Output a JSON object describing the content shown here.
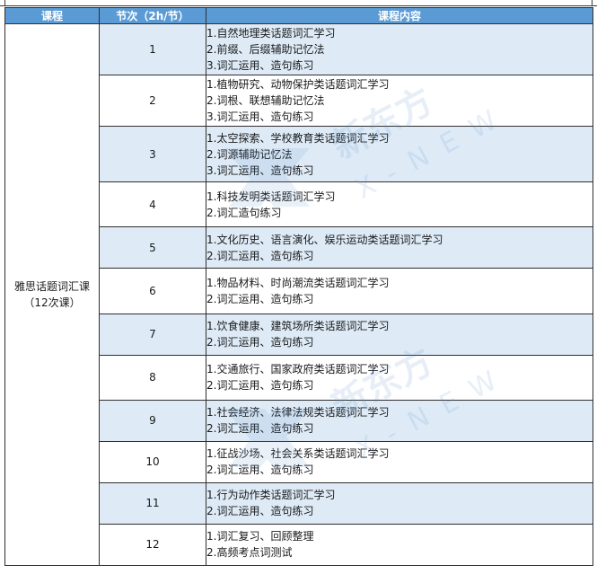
{
  "headers": {
    "course": "课程",
    "session": "节次（2h/节）",
    "content": "课程内容"
  },
  "course": {
    "name": "雅思话题词汇课",
    "count": "（12次课）"
  },
  "rows": [
    {
      "num": "1",
      "lines": [
        "1.自然地理类话题词汇学习",
        "2.前缀、后缀辅助记忆法",
        "3.词汇运用、造句练习"
      ]
    },
    {
      "num": "2",
      "lines": [
        "1.植物研究、动物保护类话题词汇学习",
        "2.词根、联想辅助记忆法",
        "3.词汇运用、造句练习"
      ]
    },
    {
      "num": "3",
      "lines": [
        "1.太空探索、学校教育类话题词汇学习",
        "2.词源辅助记忆法",
        "3.词汇运用、造句练习"
      ]
    },
    {
      "num": "4",
      "lines": [
        "1.科技发明类话题词汇学习",
        "2.词汇造句练习"
      ]
    },
    {
      "num": "5",
      "lines": [
        "1.文化历史、语言演化、娱乐运动类话题词汇学习",
        "2.词汇运用、造句练习"
      ]
    },
    {
      "num": "6",
      "lines": [
        "1.物品材料、时尚潮流类话题词汇学习",
        "2.词汇运用、造句练习"
      ]
    },
    {
      "num": "7",
      "lines": [
        "1.饮食健康、建筑场所类话题词汇学习",
        "2.词汇运用、造句练习"
      ]
    },
    {
      "num": "8",
      "lines": [
        "1.交通旅行、国家政府类话题词汇学习",
        "2.词汇运用、造句练习"
      ]
    },
    {
      "num": "9",
      "lines": [
        "1.社会经济、法律法规类话题词汇学习",
        "2.词汇运用、造句练习"
      ]
    },
    {
      "num": "10",
      "lines": [
        "1.征战沙场、社会关系类话题词汇学习",
        "2.词汇运用、造句练习"
      ]
    },
    {
      "num": "11",
      "lines": [
        "1.行为动作类话题词汇学习",
        "2.词汇运用、造句练习"
      ]
    },
    {
      "num": "12",
      "lines": [
        "1.词汇复习、回顾整理",
        "2.高频考点词测试"
      ]
    }
  ],
  "watermark": {
    "brand": "新东方",
    "sub": "X-NEW",
    "icon": "x-new-logo-icon"
  },
  "colors": {
    "header_bg": "#5b9bd5",
    "shade_bg": "#deebf7",
    "border": "#2f2f2f"
  }
}
